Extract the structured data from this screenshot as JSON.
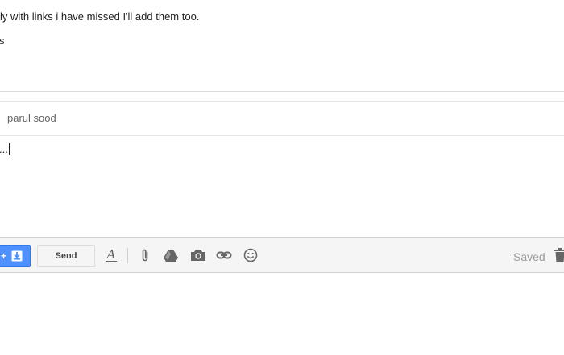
{
  "quoted": {
    "line1": "ly with links i have missed I'll add them too.",
    "line2": "s"
  },
  "recipients": {
    "name": "parul sood"
  },
  "body": {
    "text": "..."
  },
  "toolbar": {
    "addon_label": "+",
    "send_label": "Send",
    "status": "Saved",
    "icons": [
      "formatting-icon",
      "attach-icon",
      "drive-icon",
      "photo-icon",
      "link-icon",
      "emoji-icon",
      "trash-icon"
    ],
    "accent_color": "#4d90fe"
  }
}
